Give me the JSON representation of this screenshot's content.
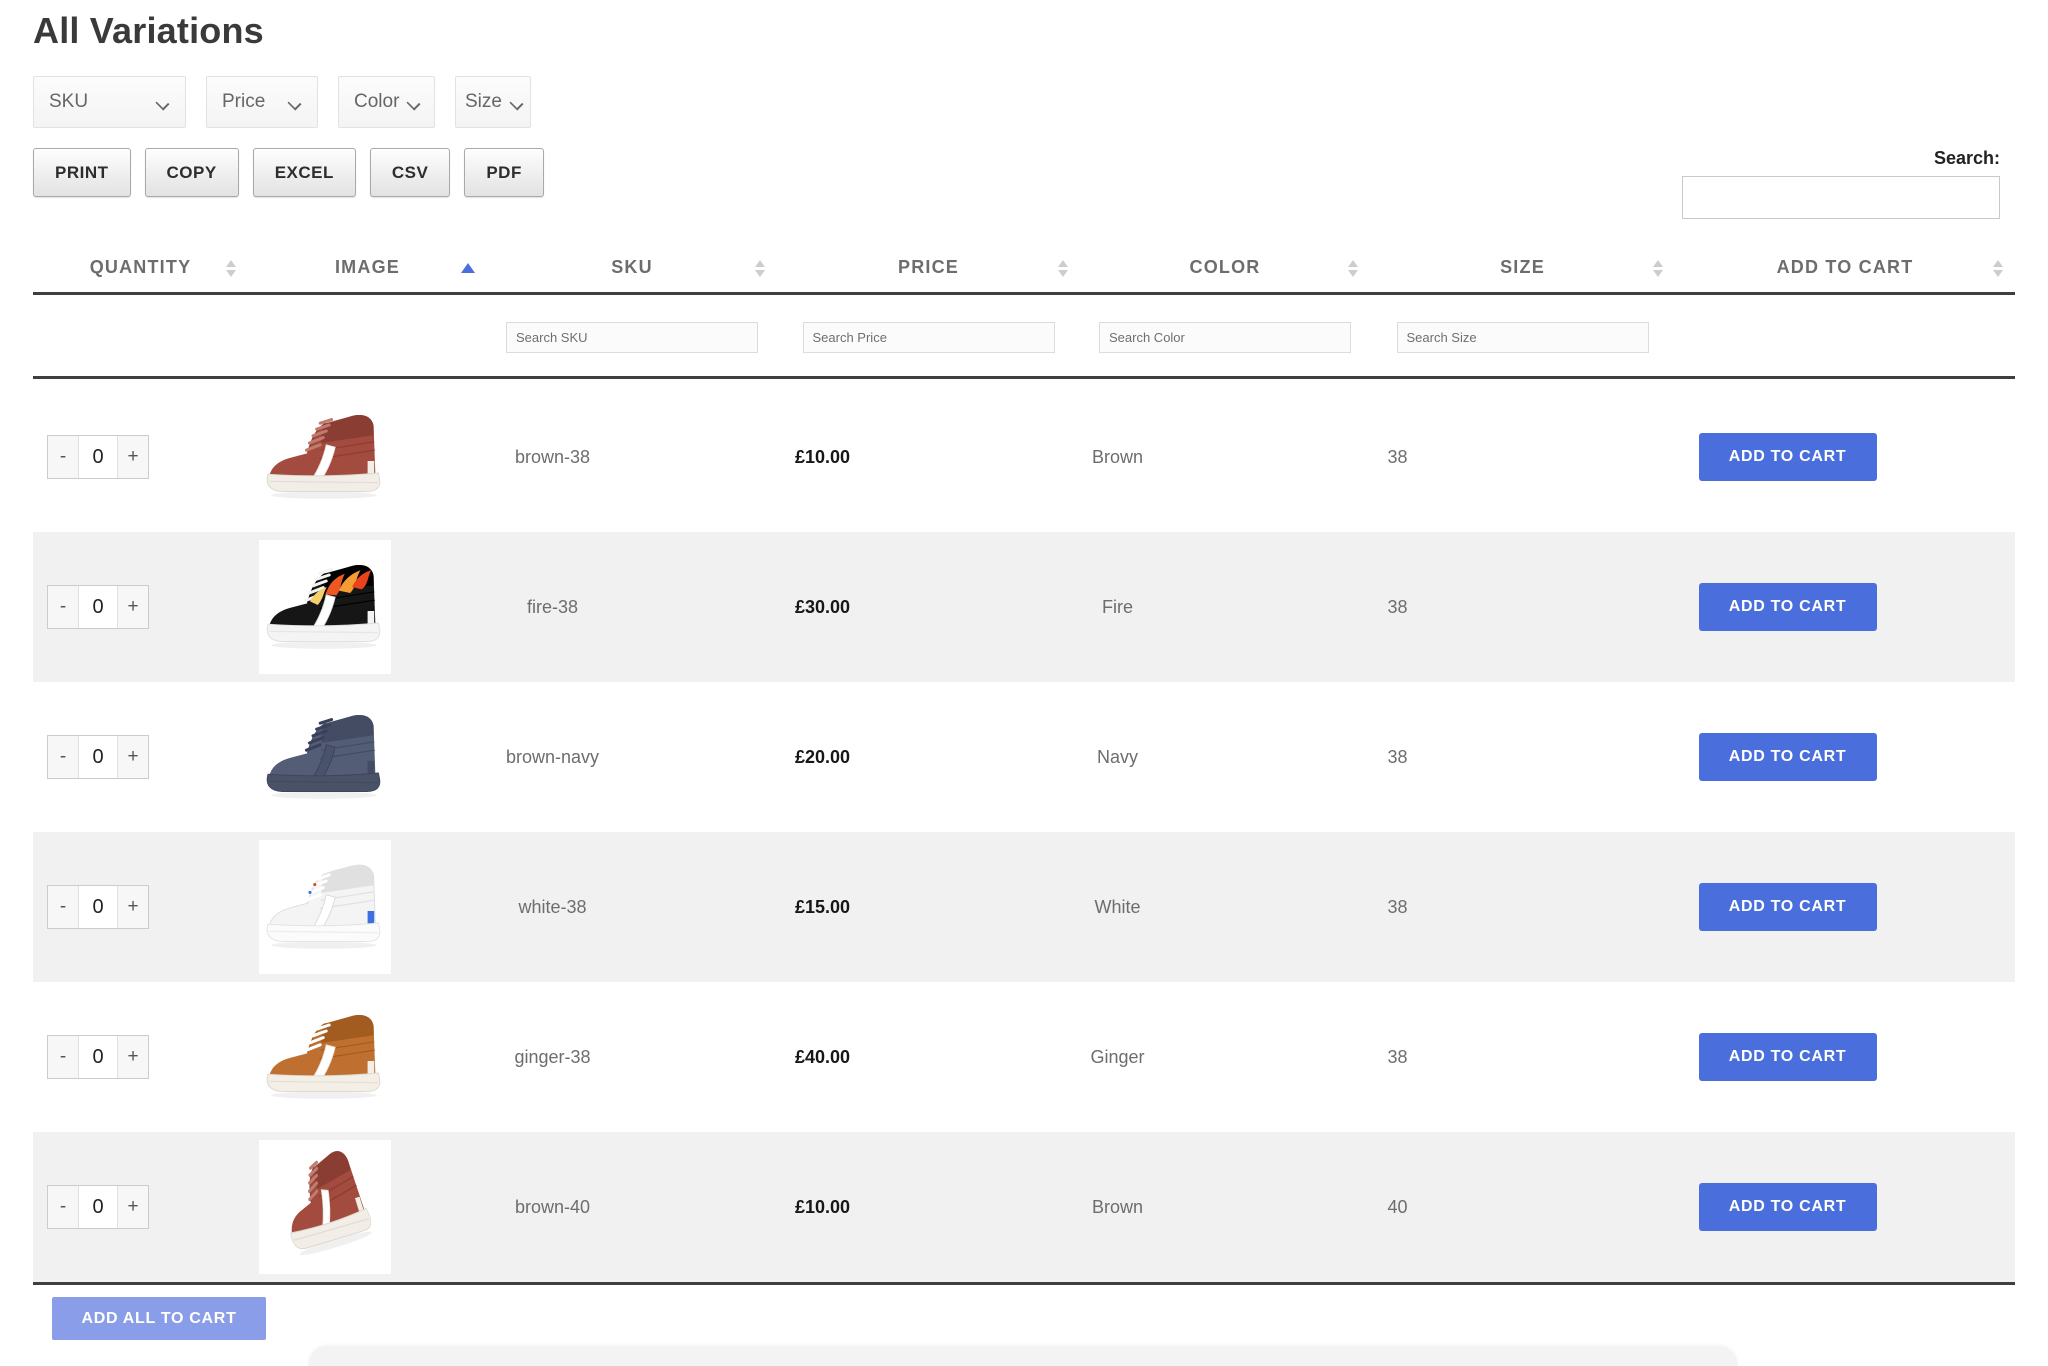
{
  "page": {
    "title": "All Variations"
  },
  "toolbar": {
    "dropdowns": [
      {
        "label": "SKU"
      },
      {
        "label": "Price"
      },
      {
        "label": "Color"
      },
      {
        "label": "Size"
      }
    ],
    "export_buttons": [
      {
        "label": "PRINT"
      },
      {
        "label": "COPY"
      },
      {
        "label": "EXCEL"
      },
      {
        "label": "CSV"
      },
      {
        "label": "PDF"
      }
    ],
    "search_label": "Search:",
    "search_value": ""
  },
  "table": {
    "columns": [
      {
        "label": "QUANTITY",
        "sort": "both"
      },
      {
        "label": "IMAGE",
        "sort": "asc"
      },
      {
        "label": "SKU",
        "sort": "both"
      },
      {
        "label": "PRICE",
        "sort": "both"
      },
      {
        "label": "COLOR",
        "sort": "both"
      },
      {
        "label": "SIZE",
        "sort": "both"
      },
      {
        "label": "ADD TO CART",
        "sort": "both"
      }
    ],
    "filters": [
      {
        "placeholder": "Search SKU"
      },
      {
        "placeholder": "Search Price"
      },
      {
        "placeholder": "Search Color"
      },
      {
        "placeholder": "Search Size"
      }
    ],
    "stepper": {
      "minus": "-",
      "plus": "+"
    },
    "add_to_cart_label": "ADD TO CART",
    "rows": [
      {
        "qty": "0",
        "sku": "brown-38",
        "price": "£10.00",
        "color": "Brown",
        "size": "38",
        "image": {
          "variant": "brown",
          "pose": "side",
          "palette": {
            "upper": "#a34b3e",
            "upperDark": "#8a3d33",
            "laces": "#c07c6f",
            "stripe": "#ffffff",
            "stripeEdge": "#e8e2da",
            "sole": "#f2eee7",
            "soleEdge": "#ddd6cc",
            "soleLine": "#e3ddd3",
            "heel": "#f2eee7"
          }
        }
      },
      {
        "qty": "0",
        "sku": "fire-38",
        "price": "£30.00",
        "color": "Fire",
        "size": "38",
        "image": {
          "variant": "fire",
          "pose": "side",
          "palette": {
            "upper": "#161616",
            "upperDark": "#000000",
            "laces": "#f2f2f2",
            "stripe": "#ffffff",
            "stripeEdge": "#d8d8d8",
            "sole": "#f4f4f4",
            "soleEdge": "#dddddd",
            "soleLine": "#e6e6e6",
            "heel": "#f4f4f4"
          }
        }
      },
      {
        "qty": "0",
        "sku": "brown-navy",
        "price": "£20.00",
        "color": "Navy",
        "size": "38",
        "image": {
          "variant": "navy",
          "pose": "side",
          "palette": {
            "upper": "#535d75",
            "upperDark": "#434c63",
            "laces": "#39415a",
            "stripe": "#49536b",
            "stripeEdge": "#3a4158",
            "sole": "#4a5268",
            "soleEdge": "#3d4457",
            "soleLine": "#414a5f",
            "heel": "#434c63"
          }
        }
      },
      {
        "qty": "0",
        "sku": "white-38",
        "price": "£15.00",
        "color": "White",
        "size": "38",
        "image": {
          "variant": "white",
          "pose": "side",
          "palette": {
            "upper": "#f4f4f4",
            "upperDark": "#e0e0e0",
            "laces": "#ffffff",
            "stripe": "#ffffff",
            "stripeEdge": "#d9d9d9",
            "sole": "#fbfbfb",
            "soleEdge": "#e2e2e2",
            "soleLine": "#ececec",
            "heel": "#3b6fe0",
            "outline": "#dcdcdc"
          }
        }
      },
      {
        "qty": "0",
        "sku": "ginger-38",
        "price": "£40.00",
        "color": "Ginger",
        "size": "38",
        "image": {
          "variant": "ginger",
          "pose": "side",
          "palette": {
            "upper": "#bf7030",
            "upperDark": "#a25c1f",
            "laces": "#ffffff",
            "stripe": "#ffffff",
            "stripeEdge": "#e8ddd0",
            "sole": "#f3efe7",
            "soleEdge": "#ded7ca",
            "soleLine": "#e6dfd2",
            "heel": "#f3efe7"
          }
        }
      },
      {
        "qty": "0",
        "sku": "brown-40",
        "price": "£10.00",
        "color": "Brown",
        "size": "40",
        "image": {
          "variant": "brown",
          "pose": "angled",
          "palette": {
            "upper": "#a34b3e",
            "upperDark": "#8a3d33",
            "laces": "#c07c6f",
            "stripe": "#ffffff",
            "stripeEdge": "#e8e2da",
            "sole": "#f2eee7",
            "soleEdge": "#ddd6cc",
            "soleLine": "#e3ddd3",
            "heel": "#f2eee7"
          }
        }
      }
    ]
  },
  "footer": {
    "add_all_label": "ADD ALL TO CART"
  },
  "colors": {
    "accent": "#4a6fdc",
    "add_all": "#8a9de8",
    "row_alt": "#f1f1f1"
  }
}
